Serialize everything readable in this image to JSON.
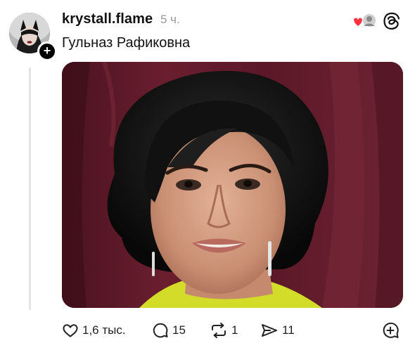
{
  "post": {
    "username": "krystall.flame",
    "time": "5 ч.",
    "text": "Гульназ Рафиковна"
  },
  "author": {
    "follow_symbol": "+"
  },
  "actions": {
    "likes": "1,6 тыс.",
    "replies": "15",
    "reposts": "1",
    "shares": "11"
  },
  "icons": {
    "like": "heart-icon",
    "reply": "comment-icon",
    "repost": "repost-icon",
    "share": "send-icon",
    "quote": "quote-add-icon",
    "app": "threads-logo-icon"
  },
  "colors": {
    "background": "#ffffff",
    "text": "#111111",
    "muted": "#9a9a9a",
    "like_red": "#ff3040",
    "backdrop": "#5a1826",
    "dress": "#d4dc2a"
  }
}
